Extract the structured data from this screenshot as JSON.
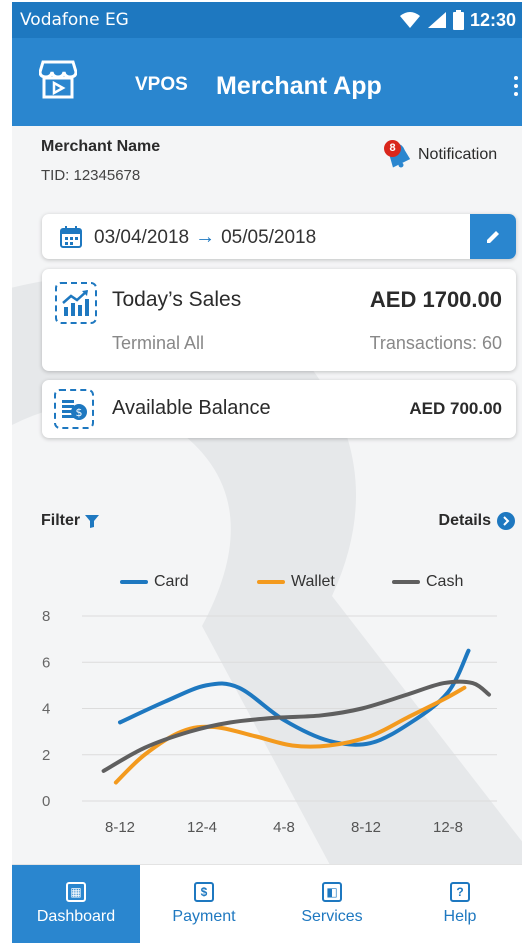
{
  "status_bar": {
    "carrier": "Vodafone EG",
    "time": "12:30"
  },
  "app_bar": {
    "brand": "VPOS",
    "title": "Merchant App"
  },
  "merchant": {
    "name": "Merchant Name",
    "tid": "TID: 12345678"
  },
  "notification": {
    "count": "8",
    "label": "Notification"
  },
  "date_range": {
    "from": "03/04/2018",
    "to": "05/05/2018"
  },
  "sales": {
    "title": "Today’s Sales",
    "amount": "AED 1700.00",
    "terminal": "Terminal All",
    "transactions": "Transactions: 60"
  },
  "balance": {
    "title": "Available Balance",
    "amount": "AED 700.00"
  },
  "controls": {
    "filter_label": "Filter",
    "details_label": "Details"
  },
  "colors": {
    "primary": "#2a86cf",
    "card": "#1e78c0",
    "wallet": "#f39a1e",
    "cash": "#5f5f5f"
  },
  "chart_data": {
    "type": "line",
    "categories": [
      "8-12",
      "12-4",
      "4-8",
      "8-12",
      "12-8"
    ],
    "ylim": [
      0,
      8
    ],
    "yticks": [
      "0",
      "2",
      "4",
      "6",
      "8"
    ],
    "series": [
      {
        "name": "Card",
        "color": "#1e78c0",
        "points": [
          [
            0,
            3.4
          ],
          [
            0.55,
            4.3
          ],
          [
            1.05,
            5.0
          ],
          [
            1.45,
            4.9
          ],
          [
            2.0,
            3.5
          ],
          [
            2.55,
            2.6
          ],
          [
            3.05,
            2.5
          ],
          [
            3.55,
            3.4
          ],
          [
            4.0,
            4.7
          ],
          [
            4.25,
            6.5
          ]
        ]
      },
      {
        "name": "Wallet",
        "color": "#f39a1e",
        "points": [
          [
            -0.05,
            0.8
          ],
          [
            0.3,
            2.0
          ],
          [
            0.75,
            3.0
          ],
          [
            1.15,
            3.2
          ],
          [
            1.65,
            2.8
          ],
          [
            2.1,
            2.4
          ],
          [
            2.55,
            2.4
          ],
          [
            3.05,
            2.8
          ],
          [
            3.5,
            3.6
          ],
          [
            3.95,
            4.4
          ],
          [
            4.2,
            4.9
          ]
        ]
      },
      {
        "name": "Cash",
        "color": "#5f5f5f",
        "points": [
          [
            -0.2,
            1.3
          ],
          [
            0.3,
            2.3
          ],
          [
            0.85,
            3.0
          ],
          [
            1.35,
            3.4
          ],
          [
            1.9,
            3.6
          ],
          [
            2.45,
            3.7
          ],
          [
            2.95,
            4.0
          ],
          [
            3.5,
            4.6
          ],
          [
            3.95,
            5.1
          ],
          [
            4.3,
            5.1
          ],
          [
            4.5,
            4.6
          ]
        ]
      }
    ]
  },
  "bottom_nav": [
    {
      "label": "Dashboard",
      "icon": "dashboard-icon",
      "glyph": "▦",
      "active": true
    },
    {
      "label": "Payment",
      "icon": "payment-icon",
      "glyph": "$",
      "active": false
    },
    {
      "label": "Services",
      "icon": "services-icon",
      "glyph": "◧",
      "active": false
    },
    {
      "label": "Help",
      "icon": "help-icon",
      "glyph": "?",
      "active": false
    }
  ]
}
